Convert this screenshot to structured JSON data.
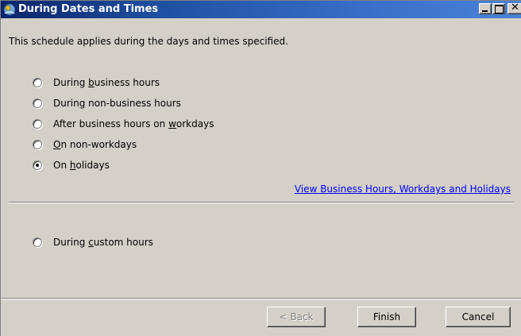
{
  "window": {
    "title": "During Dates and Times"
  },
  "intro": "This schedule applies during the days and times specified.",
  "options": [
    {
      "pre": "During ",
      "key": "b",
      "post": "usiness hours",
      "checked": false
    },
    {
      "pre": "Durin",
      "key": "g",
      "post": " non-business hours",
      "checked": false
    },
    {
      "pre": "After business hours on ",
      "key": "w",
      "post": "orkdays",
      "checked": false
    },
    {
      "pre": "",
      "key": "O",
      "post": "n non-workdays",
      "checked": false
    },
    {
      "pre": "On ",
      "key": "h",
      "post": "olidays",
      "checked": true
    }
  ],
  "link": "View Business Hours, Workdays and Holidays",
  "custom_option": {
    "pre": "During ",
    "key": "c",
    "post": "ustom hours",
    "checked": false
  },
  "buttons": {
    "back": "< Back",
    "finish": "Finish",
    "cancel": "Cancel"
  }
}
